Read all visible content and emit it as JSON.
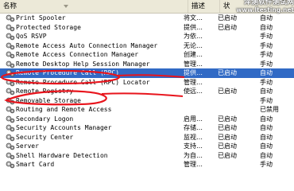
{
  "columns": {
    "name": "名称",
    "description": "描述",
    "status": "状",
    "startup": ""
  },
  "watermark": {
    "main": "泽测软件测试网",
    "url": "www.ltesting.net"
  },
  "rows": [
    {
      "name": "Print Spooler",
      "description": "将文…",
      "status": "已启动",
      "startup": "自动"
    },
    {
      "name": "Protected Storage",
      "description": "提供…",
      "status": "已启动",
      "startup": "自动"
    },
    {
      "name": "QoS RSVP",
      "description": "为依…",
      "status": "",
      "startup": "手动"
    },
    {
      "name": "Remote Access Auto Connection Manager",
      "description": "无论…",
      "status": "",
      "startup": "手动"
    },
    {
      "name": "Remote Access Connection Manager",
      "description": "创建…",
      "status": "",
      "startup": "手动"
    },
    {
      "name": "Remote Desktop Help Session Manager",
      "description": "管理…",
      "status": "",
      "startup": "手动"
    },
    {
      "name": "Remote Procedure Call (RPC)",
      "description": "提供…",
      "status": "已启动",
      "startup": "自动"
    },
    {
      "name": "Remote Procedure Call (RPC) Locator",
      "description": "管理…",
      "status": "",
      "startup": "手动"
    },
    {
      "name": "Remote Registry",
      "description": "使远…",
      "status": "已启动",
      "startup": "自动"
    },
    {
      "name": "Removable Storage",
      "description": "",
      "status": "",
      "startup": "手动"
    },
    {
      "name": "Routing and Remote Access",
      "description": "",
      "status": "",
      "startup": "已禁用"
    },
    {
      "name": "Secondary Logon",
      "description": "启用…",
      "status": "已启动",
      "startup": "自动"
    },
    {
      "name": "Security Accounts Manager",
      "description": "存储…",
      "status": "已启动",
      "startup": "自动"
    },
    {
      "name": "Security Center",
      "description": "监视…",
      "status": "已启动",
      "startup": "自动"
    },
    {
      "name": "Server",
      "description": "支持…",
      "status": "已启动",
      "startup": "自动"
    },
    {
      "name": "Shell Hardware Detection",
      "description": "为自…",
      "status": "已启动",
      "startup": "自动"
    },
    {
      "name": "Smart Card",
      "description": "管理…",
      "status": "",
      "startup": "手动"
    }
  ],
  "selected_row": 6,
  "colors": {
    "selection": "#316ac5",
    "annotation": "#e8141c",
    "header": "#ece9d8"
  }
}
